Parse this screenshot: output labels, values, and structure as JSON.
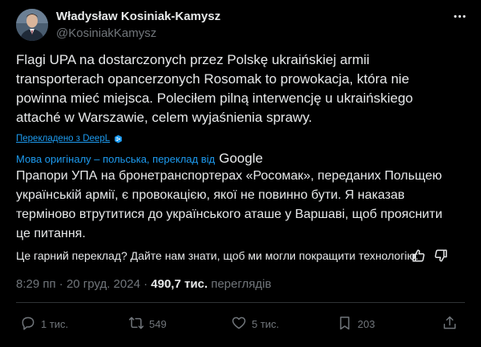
{
  "author": {
    "name": "Władysław Kosiniak-Kamysz",
    "handle": "@KosiniakKamysz"
  },
  "tweet": {
    "lines": [
      "Flagi UPA na dostarczonych przez Polskę ukraińskiej armii",
      "transporterach opancerzonych Rosomak to prowokacja, która nie",
      "powinna mieć miejsca. Poleciłem pilną interwencję u ukraińskiego",
      "attaché w Warszawie, celem wyjaśnienia sprawy."
    ]
  },
  "deepl_link": "Перекладено з DeepL",
  "translation": {
    "source_label": "Мова оригіналу – польська, переклад від",
    "provider": "Google",
    "lines": [
      "Прапори УПА на бронетранспортерах «Росомак», переданих Польщею",
      "українській армії, є провокацією, якої не повинно бути. Я наказав",
      "терміново втрутитися до українського аташе у Варшаві, щоб прояснити",
      "це питання."
    ],
    "feedback_prompt": "Це гарний переклад? Дайте нам знати, щоб ми могли покращити технологію:"
  },
  "meta": {
    "time": "8:29 пп",
    "separator": "·",
    "date": "20 груд. 2024",
    "views_count": "490,7 тис.",
    "views_label": "переглядів"
  },
  "actions": {
    "replies": "1 тис.",
    "reposts": "549",
    "likes": "5 тис.",
    "bookmarks": "203"
  },
  "colors": {
    "background": "#000000",
    "text": "#e7e9ea",
    "secondary": "#71767b",
    "link": "#1d9bf0",
    "divider": "#2f3336"
  },
  "icons": {
    "avatar": "avatar",
    "more": "more-icon",
    "deepl": "deepl-icon",
    "thumbs_up": "thumbs-up-icon",
    "thumbs_down": "thumbs-down-icon",
    "reply": "reply-icon",
    "repost": "repost-icon",
    "like": "heart-icon",
    "bookmark": "bookmark-icon",
    "share": "share-icon"
  }
}
